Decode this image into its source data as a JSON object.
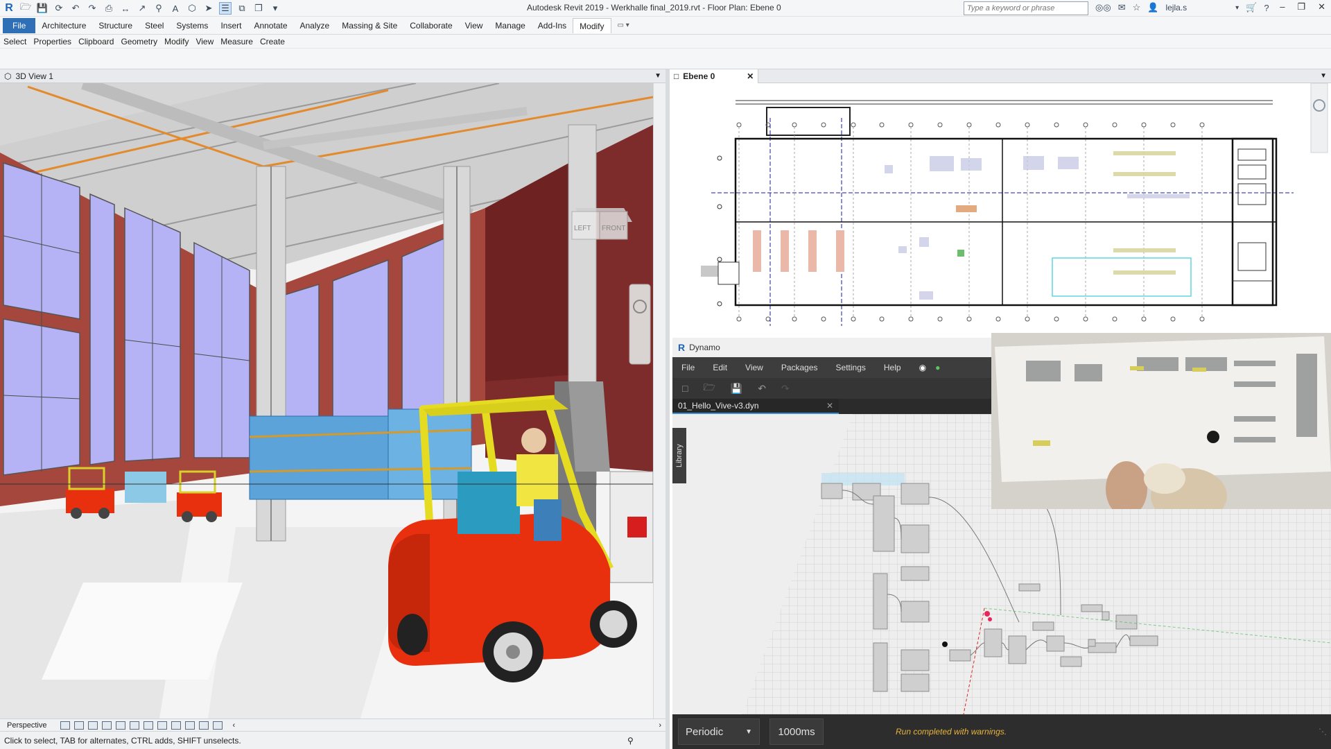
{
  "titlebar": {
    "title": "Autodesk Revit 2019 - Werkhalle final_2019.rvt - Floor Plan: Ebene 0",
    "search_placeholder": "Type a keyword or phrase",
    "user": "lejla.s"
  },
  "ribbon": {
    "tabs": [
      {
        "label": "File"
      },
      {
        "label": "Architecture"
      },
      {
        "label": "Structure"
      },
      {
        "label": "Steel"
      },
      {
        "label": "Systems"
      },
      {
        "label": "Insert"
      },
      {
        "label": "Annotate"
      },
      {
        "label": "Analyze"
      },
      {
        "label": "Massing & Site"
      },
      {
        "label": "Collaborate"
      },
      {
        "label": "View"
      },
      {
        "label": "Manage"
      },
      {
        "label": "Add-Ins"
      },
      {
        "label": "Modify"
      }
    ],
    "panels": [
      "Select",
      "Properties",
      "Clipboard",
      "Geometry",
      "Modify",
      "View",
      "Measure",
      "Create"
    ]
  },
  "view3d": {
    "tab": "3D View 1",
    "view_style": "Perspective",
    "cube_left": "LEFT",
    "cube_front": "FRONT"
  },
  "plan": {
    "tab": "Ebene 0"
  },
  "dynamo": {
    "title": "Dynamo",
    "menu": [
      "File",
      "Edit",
      "View",
      "Packages",
      "Settings",
      "Help"
    ],
    "file_tab": "01_Hello_Vive-v3.dyn",
    "library": "Library",
    "run_mode": "Periodic",
    "interval": "1000ms",
    "status": "Run completed with warnings."
  },
  "statusbar": {
    "text": "Click to select, TAB for alternates, CTRL adds, SHIFT unselects."
  },
  "colors": {
    "accent": "#2f6fb6",
    "dynamo_dark": "#2b2b2b",
    "warning": "#e7b43c",
    "forklift_red": "#e8300e",
    "forklift_yellow": "#e5dc22"
  }
}
